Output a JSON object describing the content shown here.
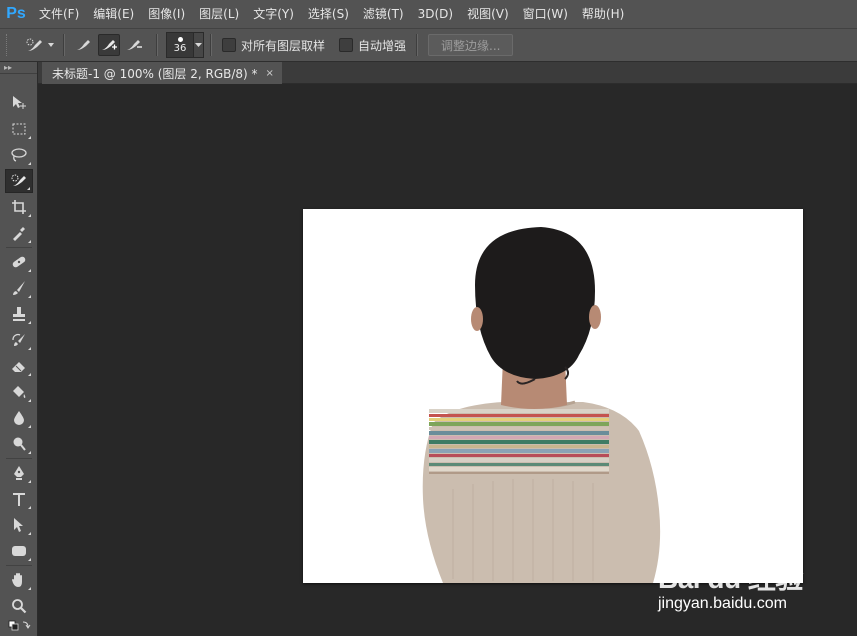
{
  "app": {
    "logo": "Ps"
  },
  "menu": [
    "文件(F)",
    "编辑(E)",
    "图像(I)",
    "图层(L)",
    "文字(Y)",
    "选择(S)",
    "滤镜(T)",
    "3D(D)",
    "视图(V)",
    "窗口(W)",
    "帮助(H)"
  ],
  "options": {
    "brush_size": "36",
    "sample_all_layers": "对所有图层取样",
    "auto_enhance": "自动增强",
    "refine_edge": "调整边缘..."
  },
  "document": {
    "tab_title": "未标题-1 @ 100% (图层 2, RGB/8) *",
    "close": "×"
  },
  "tools": [
    "move",
    "marquee",
    "lasso",
    "quick-selection",
    "crop",
    "eyedropper",
    "spot-healing",
    "brush",
    "clone-stamp",
    "history-brush",
    "eraser",
    "paint-bucket",
    "blur",
    "dodge",
    "pen",
    "type",
    "path-selection",
    "rectangle",
    "hand",
    "zoom"
  ],
  "watermark": {
    "main": "Bai du 经验",
    "sub": "jingyan.baidu.com"
  },
  "colors": {
    "ps_blue": "#31a8ff",
    "ui_gray": "#535353",
    "workspace": "#282828"
  }
}
